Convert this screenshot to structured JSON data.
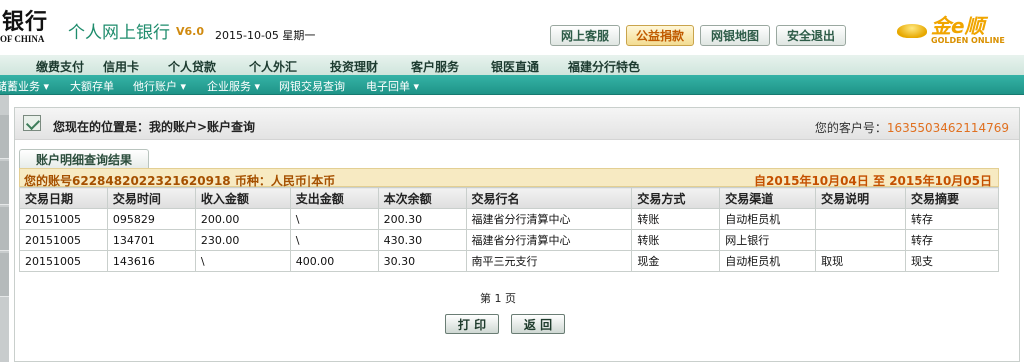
{
  "header": {
    "bank_name": "银行",
    "bank_en": "OF CHINA",
    "app_title": "个人网上银行",
    "version": "V6.0",
    "date": "2015-10-05 星期一",
    "buttons": [
      "网上客服",
      "公益捐款",
      "网银地图",
      "安全退出"
    ],
    "brand_cn": "金e顺",
    "brand_en": "GOLDEN ONLINE"
  },
  "nav_main": [
    "缴费支付",
    "信用卡",
    "个人贷款",
    "个人外汇",
    "投资理财",
    "客户服务",
    "银医直通",
    "福建分行特色"
  ],
  "nav_sub": [
    "储蓄业务 ▾",
    "大额存单",
    "他行账户 ▾",
    "企业服务 ▾",
    "网银交易查询",
    "电子回单 ▾"
  ],
  "location": {
    "text": "您现在的位置是：我的账户>账户查询",
    "customer_label": "您的客户号：",
    "customer_no": "1635503462114769"
  },
  "result": {
    "tab_title": "账户明细查询结果",
    "account_info": "您的账号6228482022321620918 币种：人民币|本币",
    "date_range": "自2015年10月04日 至 2015年10月05日"
  },
  "table": {
    "columns": [
      "交易日期",
      "交易时间",
      "收入金额",
      "支出金额",
      "本次余额",
      "交易行名",
      "交易方式",
      "交易渠道",
      "交易说明",
      "交易摘要"
    ],
    "rows": [
      [
        "20151005",
        "095829",
        "200.00",
        "\\",
        "200.30",
        "福建省分行清算中心",
        "转账",
        "自动柜员机",
        "",
        "转存"
      ],
      [
        "20151005",
        "134701",
        "230.00",
        "\\",
        "430.30",
        "福建省分行清算中心",
        "转账",
        "网上银行",
        "",
        "转存"
      ],
      [
        "20151005",
        "143616",
        "\\",
        "400.00",
        "30.30",
        "南平三元支行",
        "现金",
        "自动柜员机",
        "取现",
        "现支"
      ]
    ]
  },
  "pagination": {
    "label": "第 1 页"
  },
  "actions": {
    "print": "打 印",
    "back": "返 回"
  }
}
